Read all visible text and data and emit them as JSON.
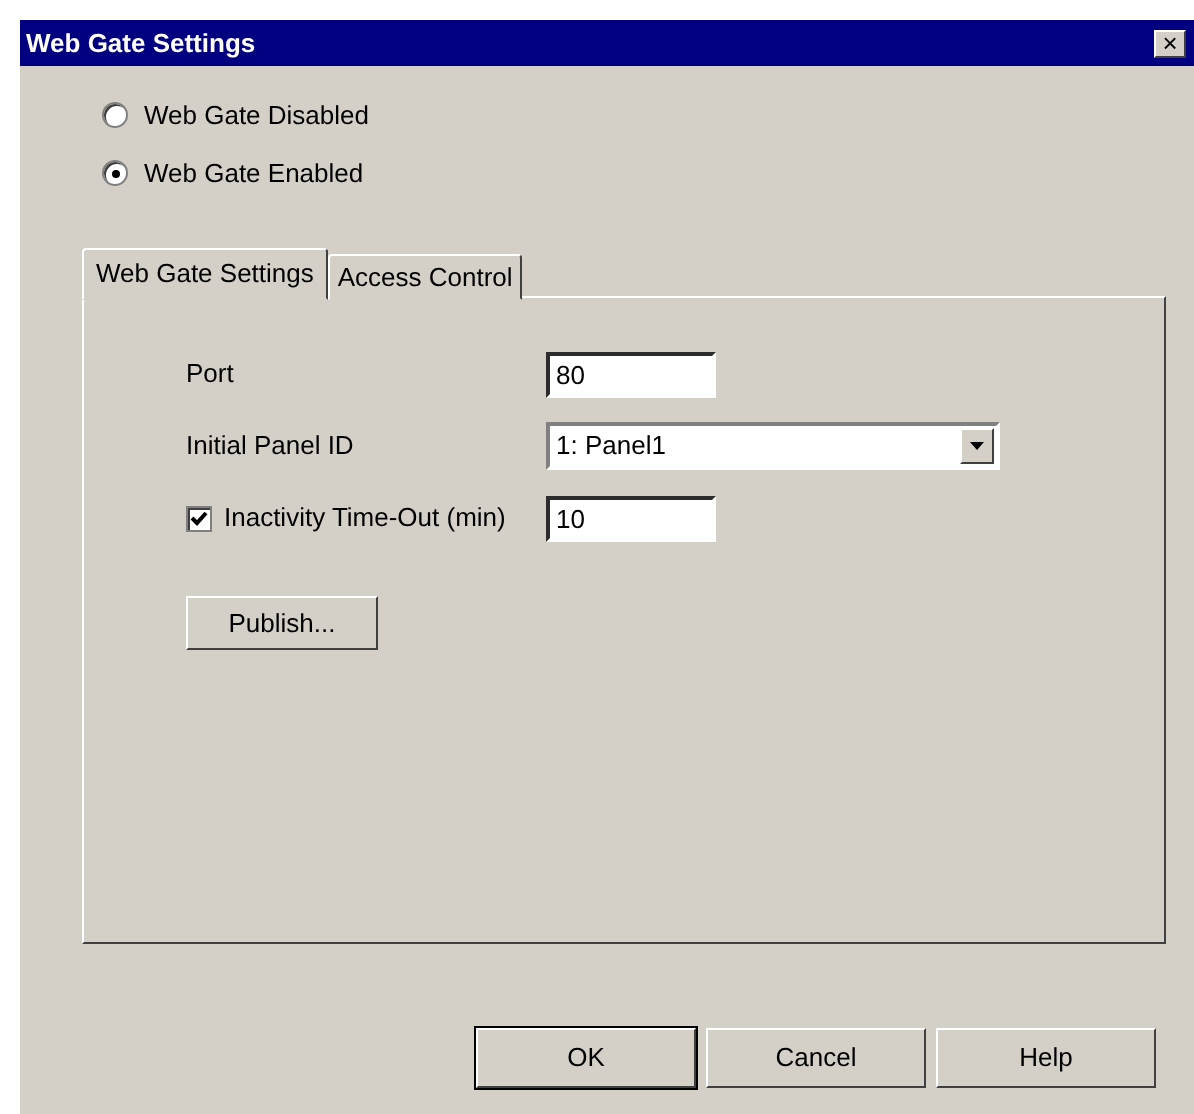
{
  "window": {
    "title": "Web Gate Settings",
    "close": "×"
  },
  "mode": [
    {
      "label": "Web Gate Disabled",
      "selected": false
    },
    {
      "label": "Web Gate Enabled",
      "selected": true
    }
  ],
  "tabs": [
    {
      "label": "Web Gate Settings",
      "selected": true
    },
    {
      "label": "Access Control",
      "selected": false
    }
  ],
  "fields": [
    {
      "kind": "text",
      "label": "Port",
      "value": "80"
    },
    {
      "kind": "select",
      "label": "Initial Panel ID",
      "value": "1: Panel1"
    },
    {
      "kind": "check",
      "label": "Inactivity Time-Out (min)",
      "checked": true,
      "value": "10"
    }
  ],
  "publish_button": "Publish...",
  "buttons": [
    {
      "label": "OK",
      "default": true
    },
    {
      "label": "Cancel",
      "default": false
    },
    {
      "label": "Help",
      "default": false
    }
  ]
}
